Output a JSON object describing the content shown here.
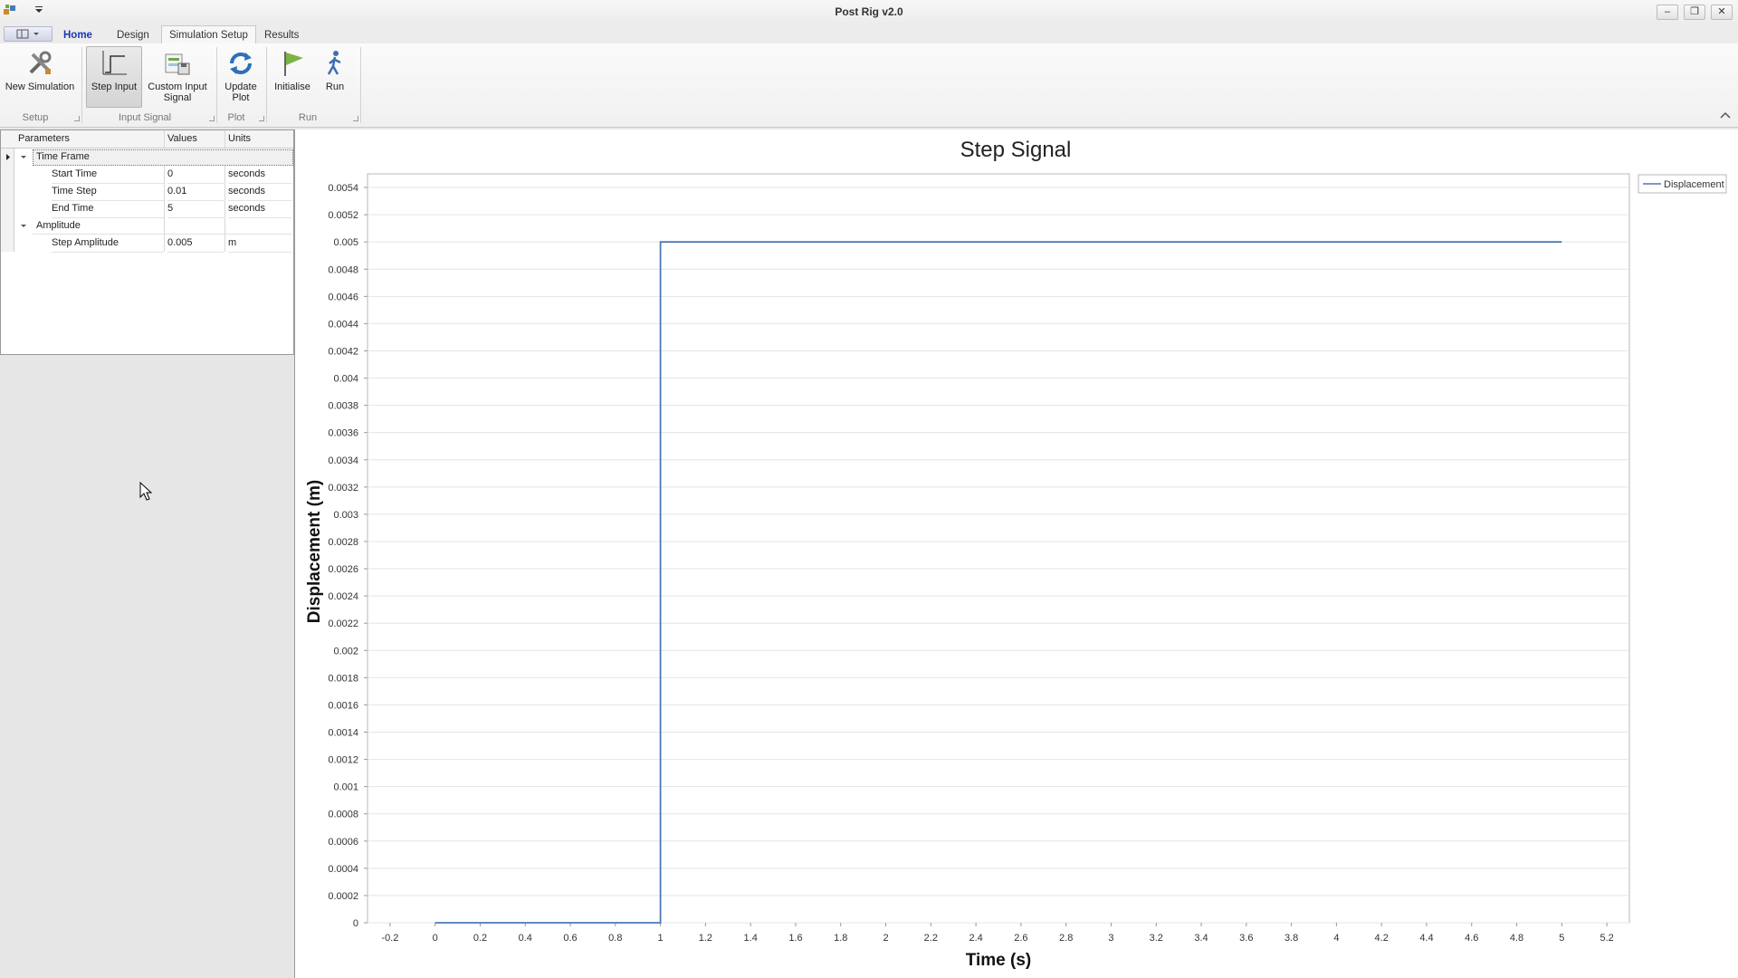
{
  "window": {
    "title": "Post Rig v2.0"
  },
  "tabs": [
    "Home",
    "Design",
    "Simulation Setup",
    "Results"
  ],
  "active_tab": "Simulation Setup",
  "ribbon": {
    "buttons": {
      "new_simulation": "New Simulation",
      "step_input": "Step Input",
      "custom_input_signal_1": "Custom Input",
      "custom_input_signal_2": "Signal",
      "update_plot_1": "Update",
      "update_plot_2": "Plot",
      "initialise": "Initialise",
      "run": "Run"
    },
    "groups": {
      "setup": "Setup",
      "input_signal": "Input Signal",
      "plot": "Plot",
      "run": "Run"
    }
  },
  "param_grid": {
    "headers": {
      "parameters": "Parameters",
      "values": "Values",
      "units": "Units"
    },
    "categories": {
      "time_frame": "Time Frame",
      "amplitude": "Amplitude"
    },
    "rows": {
      "start_time": {
        "name": "Start Time",
        "value": "0",
        "unit": "seconds"
      },
      "time_step": {
        "name": "Time Step",
        "value": "0.01",
        "unit": "seconds"
      },
      "end_time": {
        "name": "End Time",
        "value": "5",
        "unit": "seconds"
      },
      "step_amplitude": {
        "name": "Step Amplitude",
        "value": "0.005",
        "unit": "m"
      }
    }
  },
  "colors": {
    "series": "#4a7ab5",
    "tab_home": "#1a35b5"
  },
  "chart_data": {
    "type": "line",
    "title": "Step Signal",
    "xlabel": "Time (s)",
    "ylabel": "Displacement (m)",
    "xlim": [
      -0.3,
      5.3
    ],
    "ylim": [
      0,
      0.0055
    ],
    "x_ticks": [
      "-0.2",
      "0",
      "0.2",
      "0.4",
      "0.6",
      "0.8",
      "1",
      "1.2",
      "1.4",
      "1.6",
      "1.8",
      "2",
      "2.2",
      "2.4",
      "2.6",
      "2.8",
      "3",
      "3.2",
      "3.4",
      "3.6",
      "3.8",
      "4",
      "4.2",
      "4.4",
      "4.6",
      "4.8",
      "5",
      "5.2"
    ],
    "y_ticks": [
      "0",
      "0.0002",
      "0.0004",
      "0.0006",
      "0.0008",
      "0.001",
      "0.0012",
      "0.0014",
      "0.0016",
      "0.0018",
      "0.002",
      "0.0022",
      "0.0024",
      "0.0026",
      "0.0028",
      "0.003",
      "0.0032",
      "0.0034",
      "0.0036",
      "0.0038",
      "0.004",
      "0.0042",
      "0.0044",
      "0.0046",
      "0.0048",
      "0.005",
      "0.0052",
      "0.0054"
    ],
    "grid": true,
    "legend_position": "top-right",
    "series": [
      {
        "name": "Displacement",
        "x": [
          0,
          1,
          1,
          5
        ],
        "y": [
          0,
          0,
          0.005,
          0.005
        ]
      }
    ]
  }
}
